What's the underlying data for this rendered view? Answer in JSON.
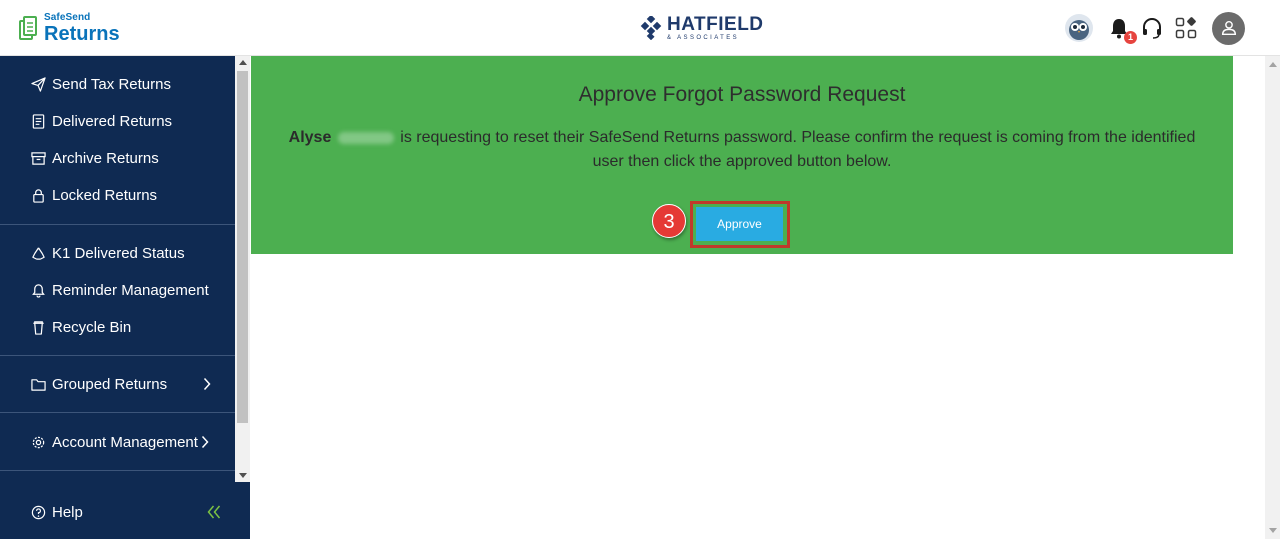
{
  "header": {
    "logo_small": "SafeSend",
    "logo_big": "Returns",
    "brand_name": "HATFIELD",
    "brand_sub": "& ASSOCIATES",
    "notification_count": "1",
    "icons": [
      "owl-avatar-icon",
      "bell-icon",
      "headset-icon",
      "apps-grid-icon",
      "user-icon"
    ]
  },
  "sidebar": {
    "items": [
      {
        "label": "Send Tax Returns",
        "icon": "send-icon"
      },
      {
        "label": "Delivered Returns",
        "icon": "document-icon"
      },
      {
        "label": "Archive Returns",
        "icon": "archive-icon"
      },
      {
        "label": "Locked Returns",
        "icon": "lock-icon"
      },
      {
        "label": "K1 Delivered Status",
        "icon": "recycle-icon"
      },
      {
        "label": "Reminder Management",
        "icon": "bell-icon"
      },
      {
        "label": "Recycle Bin",
        "icon": "trash-icon"
      },
      {
        "label": "Grouped Returns",
        "icon": "folder-icon"
      },
      {
        "label": "Account Management",
        "icon": "gear-icon"
      }
    ],
    "help_label": "Help"
  },
  "main": {
    "title": "Approve Forgot Password Request",
    "user_first_name": "Alyse",
    "message_1": "is requesting to reset their SafeSend Returns password. Please confirm the request is coming from the identified",
    "message_2": "user then click the approved button below.",
    "step_number": "3",
    "approve_label": "Approve"
  },
  "colors": {
    "sidebar_bg": "#0f2a52",
    "panel_bg": "#4caf50",
    "button_bg": "#29abe2",
    "highlight_border": "#c0392b",
    "step_badge": "#e53935",
    "brand_blue": "#0973ba"
  }
}
